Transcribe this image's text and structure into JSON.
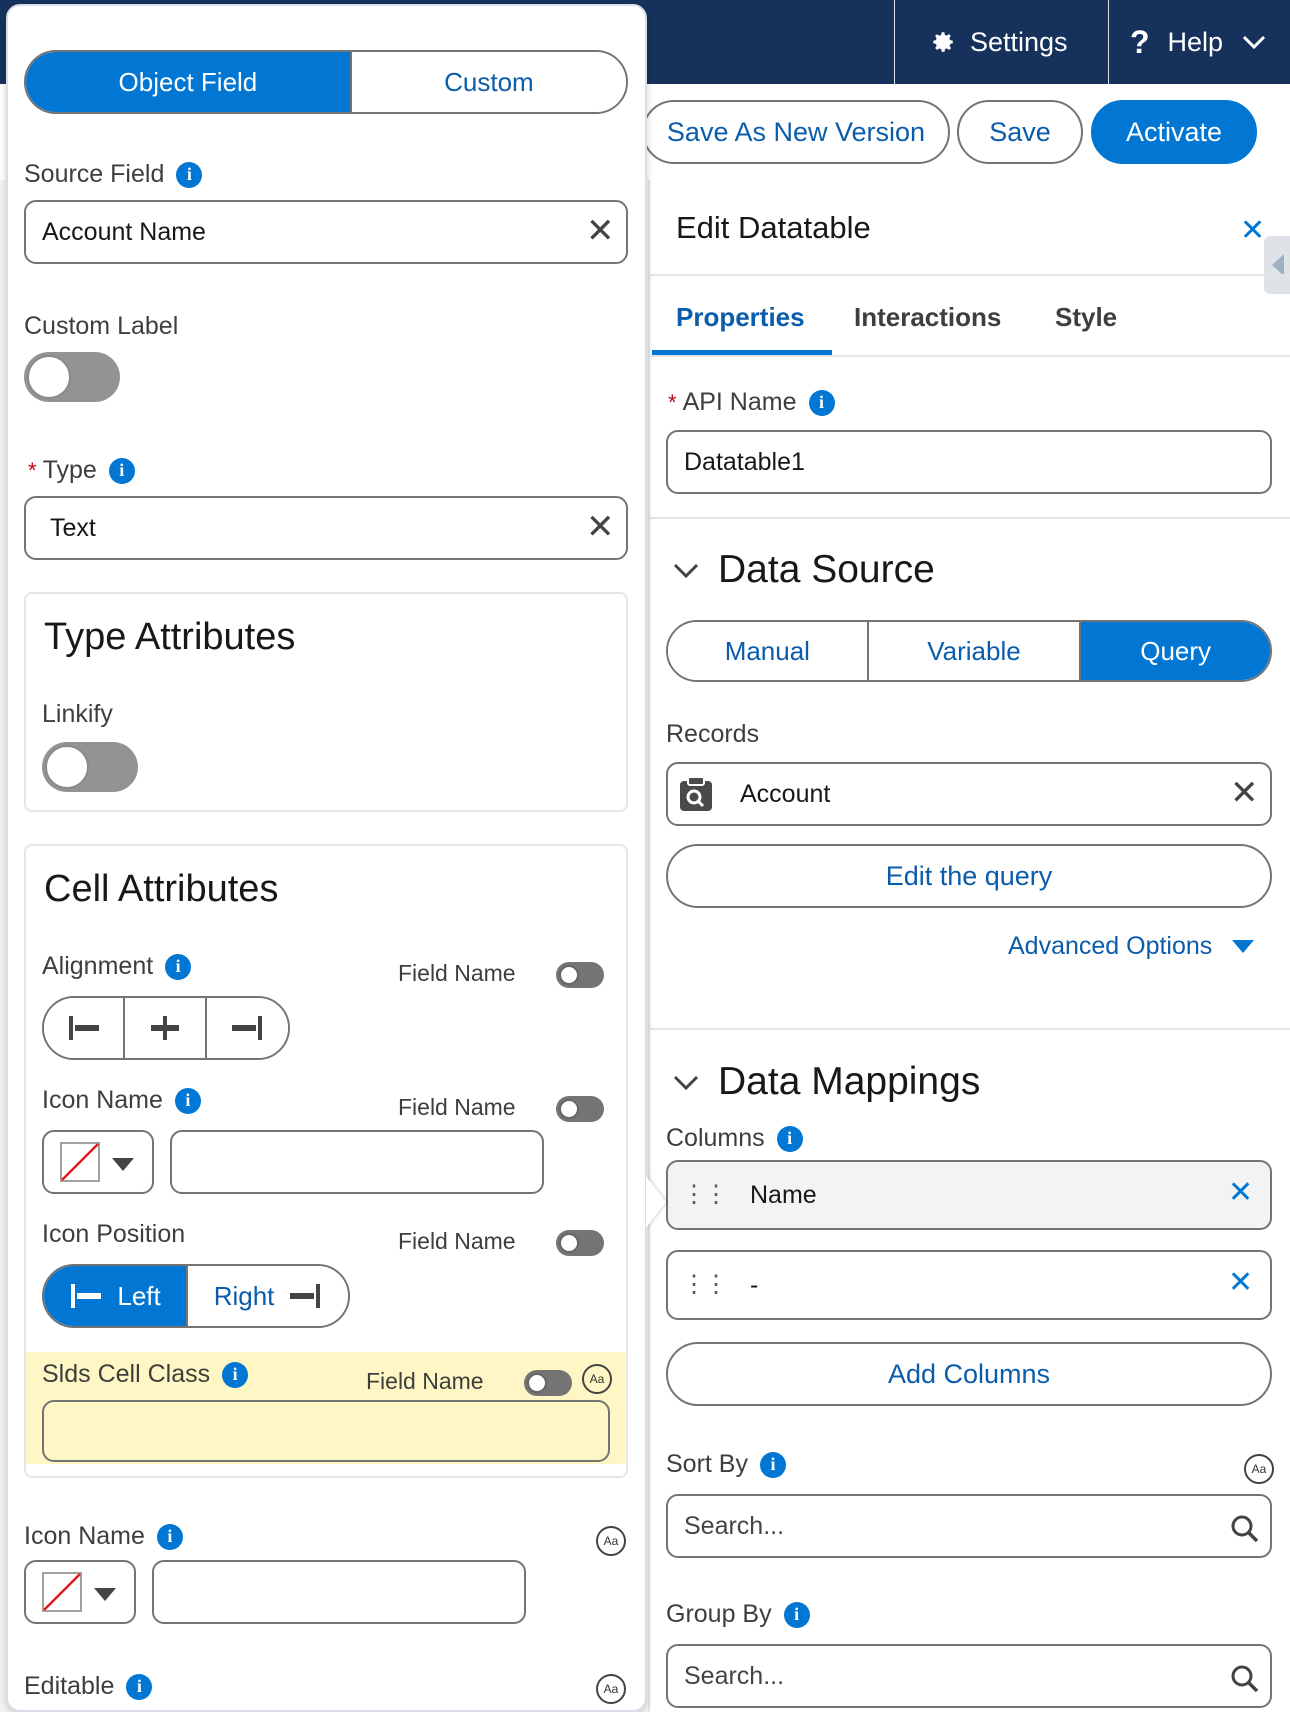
{
  "topbar": {
    "settings_label": "Settings",
    "help_label": "Help"
  },
  "toolbar": {
    "save_new_version_label": "Save As New Version",
    "save_label": "Save",
    "activate_label": "Activate"
  },
  "right_panel": {
    "title": "Edit Datatable",
    "tabs": [
      "Properties",
      "Interactions",
      "Style"
    ],
    "active_tab": "Properties",
    "api_name_label": "API Name",
    "api_name_value": "Datatable1",
    "data_source": {
      "heading": "Data Source",
      "segments": [
        "Manual",
        "Variable",
        "Query"
      ],
      "selected": "Query",
      "records_label": "Records",
      "records_value": "Account",
      "edit_query_label": "Edit the query",
      "advanced_options_label": "Advanced Options"
    },
    "data_mappings": {
      "heading": "Data Mappings",
      "columns_label": "Columns",
      "columns": [
        "Name",
        "-"
      ],
      "add_columns_label": "Add Columns",
      "sort_by_label": "Sort By",
      "sort_by_placeholder": "Search...",
      "group_by_label": "Group By",
      "group_by_placeholder": "Search..."
    }
  },
  "left_panel": {
    "mode_segments": [
      "Object Field",
      "Custom"
    ],
    "mode_selected": "Object Field",
    "source_field_label": "Source Field",
    "source_field_value": "Account Name",
    "custom_label_label": "Custom Label",
    "type_label": "Type",
    "type_value": "Text",
    "type_attributes": {
      "title": "Type Attributes",
      "linkify_label": "Linkify"
    },
    "cell_attributes": {
      "title": "Cell Attributes",
      "alignment_label": "Alignment",
      "field_name_label": "Field Name",
      "icon_name_label": "Icon Name",
      "icon_position_label": "Icon Position",
      "icon_position_options": [
        "Left",
        "Right"
      ],
      "icon_position_selected": "Left",
      "slds_cell_class_label": "Slds Cell Class"
    },
    "icon_name_label": "Icon Name",
    "editable_label": "Editable"
  },
  "colors": {
    "brand": "#0176d3",
    "link": "#0b5cab",
    "topbar": "#16325c",
    "highlight": "#fef7c5"
  }
}
